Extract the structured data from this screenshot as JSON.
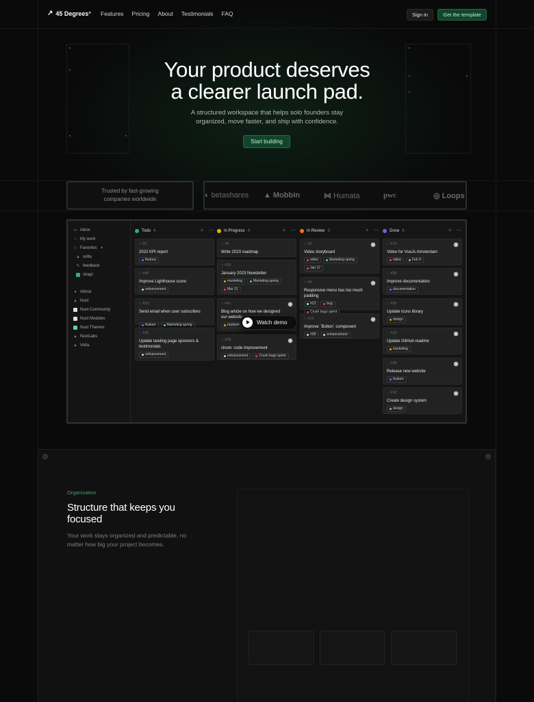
{
  "nav": {
    "logo_text": "45 Degrees°",
    "links": [
      "Features",
      "Pricing",
      "About",
      "Testimonials",
      "FAQ"
    ],
    "signin_label": "Sign in",
    "cta_label": "Get the template"
  },
  "hero": {
    "title_line1": "Your product deserves",
    "title_line2": "a clearer launch pad.",
    "subtitle_line1": "A structured workspace that helps solo founders stay",
    "subtitle_line2": "organized, move faster, and ship with confidence.",
    "button_label": "Start building"
  },
  "trusted": {
    "text": "Trusted by fast-growing companies worldwide",
    "brands": [
      "betashares",
      "Mobbin",
      "Humata",
      "pwc",
      "Loops"
    ]
  },
  "app": {
    "sidebar": {
      "top_items": [
        "Inbox",
        "My work",
        "Favorites"
      ],
      "favorites": [
        "volta",
        "feedback",
        "strapi"
      ],
      "workspaces": [
        "Atinux",
        "Nuxt",
        "Nuxt Community",
        "Nuxt Modules",
        "Nuxt Themes",
        "NuxtLabs",
        "Volta"
      ]
    },
    "columns": [
      {
        "name": "Todo",
        "count": "4",
        "color": "#2fb173",
        "cards": [
          {
            "id": "#5",
            "title": "2022 KPI report",
            "tags": [
              {
                "label": "finance",
                "color": "#3b82f6"
              }
            ]
          },
          {
            "id": "#40",
            "title": "Improve Lighthouse score",
            "tags": [
              {
                "label": "enhancement",
                "color": "#9ef0d0"
              }
            ]
          },
          {
            "id": "#33",
            "title": "Send email when user subscribes",
            "tags": [
              {
                "label": "feature",
                "color": "#8b5cf6"
              },
              {
                "label": "Marketing spring",
                "color": "#4ade80"
              }
            ]
          },
          {
            "id": "#36",
            "title": "Update landing page sponsors & testimonials",
            "tags": [
              {
                "label": "enhancement",
                "color": "#9ef0d0"
              }
            ]
          }
        ]
      },
      {
        "name": "In Progress",
        "count": "4",
        "color": "#eab308",
        "cards": [
          {
            "id": "#6",
            "title": "Write 2023 roadmap",
            "tags": []
          },
          {
            "id": "#10",
            "title": "January 2023 Newsletter",
            "tags": [
              {
                "label": "marketing",
                "color": "#f59e0b"
              },
              {
                "label": "Marketing spring",
                "color": "#4ade80"
              },
              {
                "label": "Mar 31",
                "color": "#ef4444"
              }
            ]
          },
          {
            "id": "#41",
            "title": "Blog article on how we designed our website",
            "tags": [
              {
                "label": "marketing",
                "color": "#f59e0b"
              }
            ]
          },
          {
            "id": "#28",
            "title": "chore: code improvement",
            "tags": [
              {
                "label": "enhancement",
                "color": "#9ef0d0"
              },
              {
                "label": "Crush bugs sprint",
                "color": "#ef4444"
              }
            ]
          }
        ]
      },
      {
        "name": "In Review",
        "count": "3",
        "color": "#f97316",
        "cards": [
          {
            "id": "#2",
            "title": "Video storyboard",
            "tags": [
              {
                "label": "video",
                "color": "#ef4444"
              },
              {
                "label": "Marketing spring",
                "color": "#4ade80"
              },
              {
                "label": "Jan 17",
                "color": "#ef4444"
              }
            ]
          },
          {
            "id": "#9",
            "title": "Responsive menu has too much padding",
            "tags": [
              {
                "label": "#23",
                "color": "#9ef0d0"
              },
              {
                "label": "bug",
                "color": "#ef4444"
              },
              {
                "label": "Crush bugs sprint",
                "color": "#ef4444"
              }
            ]
          },
          {
            "id": "#13",
            "title": "Improve `Button` component",
            "tags": [
              {
                "label": "#28",
                "color": "#9ef0d0"
              },
              {
                "label": "enhancement",
                "color": "#9ef0d0"
              }
            ]
          }
        ]
      },
      {
        "name": "Done",
        "count": "6",
        "color": "#6366f1",
        "cards": [
          {
            "id": "#14",
            "title": "Video for VueJs Amsterdam",
            "tags": [
              {
                "label": "video",
                "color": "#ef4444"
              },
              {
                "label": "Feb 9",
                "color": "#aaaaaa"
              }
            ]
          },
          {
            "id": "#38",
            "title": "Improve documentation",
            "tags": [
              {
                "label": "documentation",
                "color": "#3b82f6"
              }
            ]
          },
          {
            "id": "#20",
            "title": "Update icons library",
            "tags": [
              {
                "label": "design",
                "color": "#f59e0b"
              }
            ]
          },
          {
            "id": "#19",
            "title": "Update GitHub readme",
            "tags": [
              {
                "label": "marketing",
                "color": "#f59e0b"
              }
            ]
          },
          {
            "id": "#39",
            "title": "Release new website",
            "tags": [
              {
                "label": "feature",
                "color": "#8b5cf6"
              }
            ]
          },
          {
            "id": "#18",
            "title": "Create design system",
            "tags": [
              {
                "label": "design",
                "color": "#c084fc"
              }
            ]
          }
        ]
      }
    ],
    "watch_demo_label": "Watch demo"
  },
  "organization": {
    "eyebrow": "Organization",
    "title": "Structure that keeps you focused",
    "text": "Your work stays organized and predictable, no matter how big your project becomes."
  },
  "colors": {
    "accent": "#13452d",
    "accent_text": "#b7f0cf",
    "eyebrow": "#3fa46c"
  }
}
